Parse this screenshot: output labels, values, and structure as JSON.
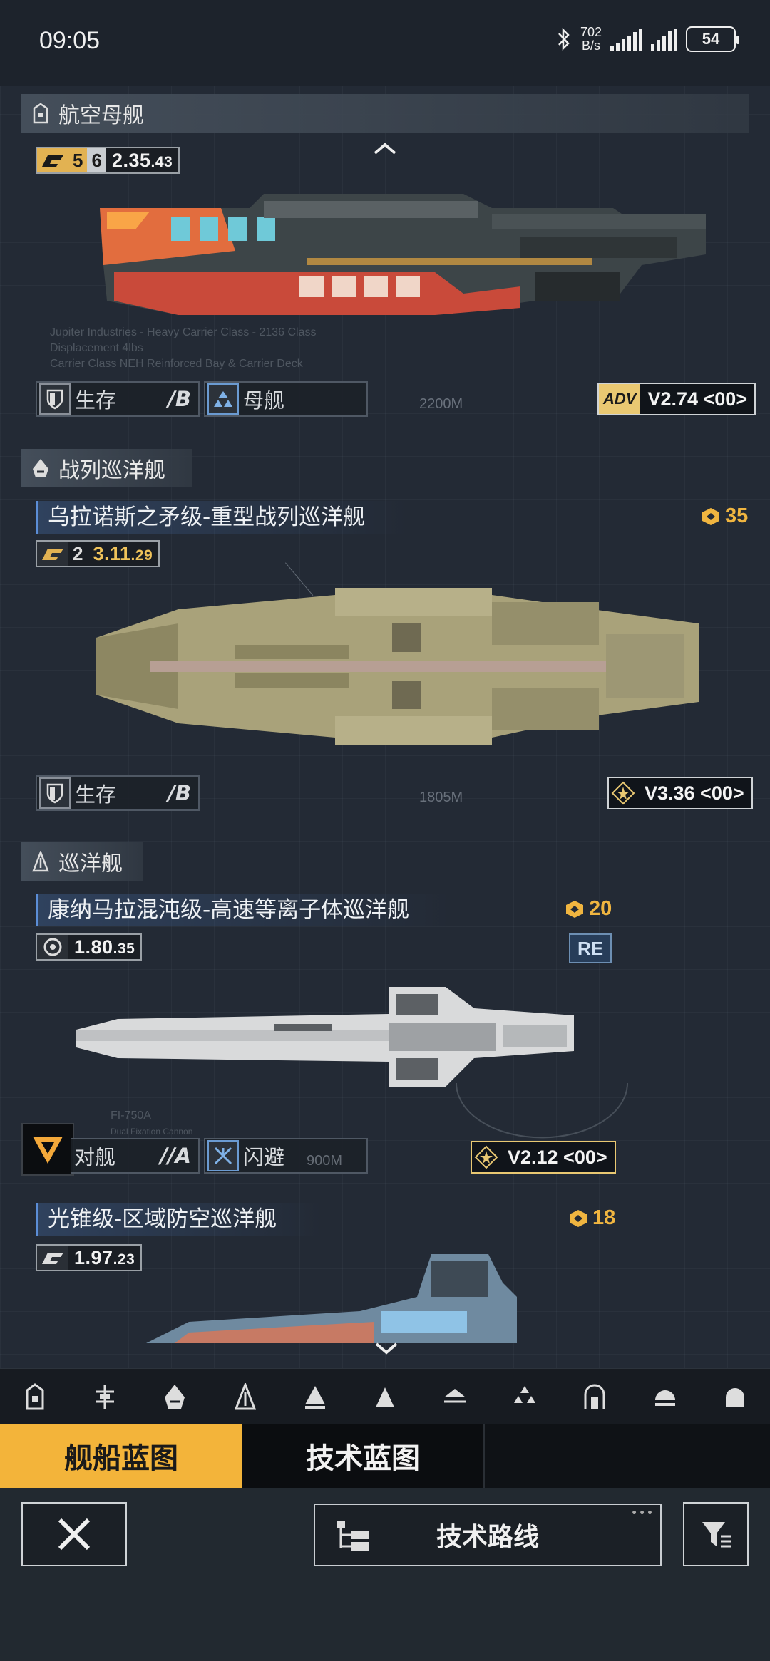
{
  "status_bar": {
    "time": "09:05",
    "net_speed_value": "702",
    "net_speed_unit": "B/s",
    "battery": "54"
  },
  "sections": {
    "carrier": {
      "title": "航空母舰"
    },
    "battlecruiser": {
      "title": "战列巡洋舰"
    },
    "cruiser": {
      "title": "巡洋舰"
    }
  },
  "ships": {
    "carrier_ship": {
      "badge_a": "5",
      "badge_b": "6",
      "version": "2.35",
      "version_sub": ".43",
      "tag1_label": "生存",
      "tag1_grade": "/B",
      "tag2_label": "母舰",
      "distance": "2200M",
      "adv_label": "ADV",
      "ver_tag": "V2.74 <00>",
      "bg_text_1": "Jupiter Industries - Heavy Carrier Class - 2136 Class",
      "bg_text_2": "Displacement 4lbs",
      "bg_text_3": "Carrier Class NEH Reinforced Bay & Carrier Deck"
    },
    "battlecruiser_ship": {
      "name": "乌拉诺斯之矛级-重型战列巡洋舰",
      "cost": "35",
      "badge_a": "2",
      "version": "3.11",
      "version_sub": ".29",
      "tag1_label": "生存",
      "tag1_grade": "/B",
      "distance": "1805M",
      "ver_tag": "V3.36 <00>"
    },
    "cruiser_ship_1": {
      "name": "康纳马拉混沌级-高速等离子体巡洋舰",
      "cost": "20",
      "version": "1.80",
      "version_sub": ".35",
      "re_tag": "RE",
      "tag1_label": "对舰",
      "tag1_grade": "//A",
      "tag2_label": "闪避",
      "distance": "900M",
      "ver_tag": "V2.12 <00>",
      "bg_label": "FI-750A",
      "bg_label_2": "Dual Fixation Cannon"
    },
    "cruiser_ship_2": {
      "name": "光锥级-区域防空巡洋舰",
      "cost": "18",
      "version": "1.97",
      "version_sub": ".23"
    }
  },
  "tabs": {
    "ship_blueprint": "舰船蓝图",
    "tech_blueprint": "技术蓝图"
  },
  "bottom": {
    "route_label": "技术路线"
  },
  "colors": {
    "accent_gold": "#f3b43a",
    "background": "#232a35",
    "cost_orange": "#f0b540"
  }
}
